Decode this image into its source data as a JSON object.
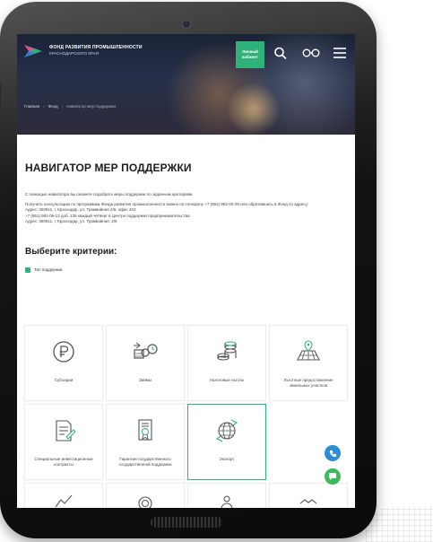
{
  "header": {
    "org_line1": "ФОНД РАЗВИТИЯ ПРОМЫШЛЕННОСТИ",
    "org_line2": "КРАСНОДАРСКОГО КРАЯ",
    "cabinet_label": "Личный кабинет"
  },
  "breadcrumb": [
    "Главная",
    "Фонд",
    "Навигатор мер поддержки"
  ],
  "page": {
    "title": "НАВИГАТОР МЕР ПОДДЕРЖКИ",
    "intro_lines": [
      "С помощью навигатора вы сможете подобрать меры поддержки по заданным критериям.",
      "Получить консультацию по программам Фонда развития промышленности можно по телефону +7 (861) 992-00-00 или обратившись в Фонд по адресу:",
      "Адрес: 350911, г. Краснодар, ул. Трамвайная 2/6, офис 403",
      "+7 (861) 991-06-13 доб. 136 каждый четверг в Центре поддержки предпринимательства",
      "Адрес: 350911, г. Краснодар, ул. Трамвайная, 2/6"
    ],
    "criteria_title": "Выберите критерии:",
    "filter_label": "Тип поддержки"
  },
  "tiles": [
    {
      "label": "Субсидии",
      "icon": "ruble-coin-icon"
    },
    {
      "label": "Займы",
      "icon": "loan-clock-icon"
    },
    {
      "label": "Налоговые льготы",
      "icon": "coins-stack-icon"
    },
    {
      "label": "Льготные предоставление земельных участков",
      "icon": "land-map-icon"
    },
    {
      "label": "Специальные инвестиционные контракты",
      "icon": "contract-document-icon"
    },
    {
      "label": "Гарантии государственного государственной поддержки",
      "icon": "certificate-icon"
    },
    {
      "label": "Экспорт",
      "icon": "globe-export-icon"
    }
  ],
  "colors": {
    "accent": "#2fb27a",
    "phone_button": "#2b8fd6",
    "chat_button": "#3dbb5a",
    "hero_dark": "#1a2236"
  }
}
